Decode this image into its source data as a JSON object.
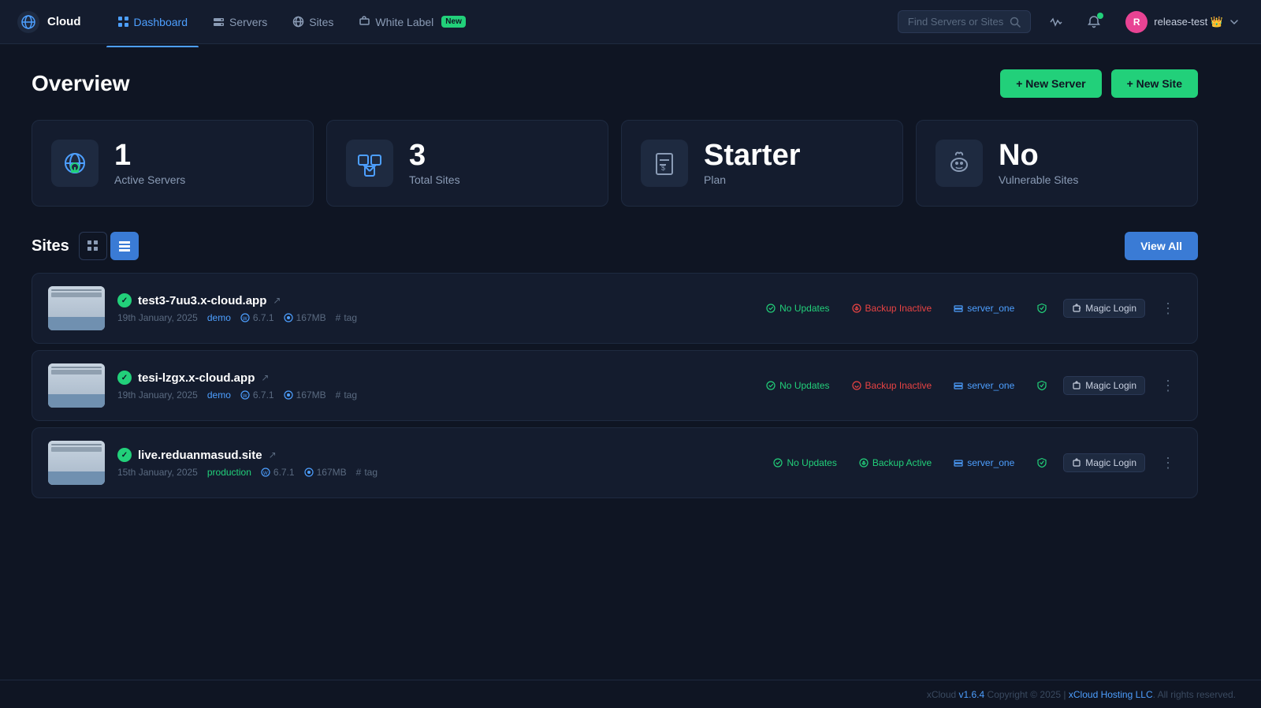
{
  "brand": {
    "name": "Cloud",
    "logo_alt": "xCloud"
  },
  "nav": {
    "items": [
      {
        "id": "dashboard",
        "label": "Dashboard",
        "active": true
      },
      {
        "id": "servers",
        "label": "Servers",
        "active": false
      },
      {
        "id": "sites",
        "label": "Sites",
        "active": false
      },
      {
        "id": "white-label",
        "label": "White Label",
        "active": false,
        "badge": "New"
      }
    ]
  },
  "search": {
    "placeholder": "Find Servers or Sites"
  },
  "user": {
    "name": "release-test",
    "avatar_initial": "R",
    "emoji": "👑"
  },
  "header": {
    "title": "Overview",
    "new_server_label": "+ New Server",
    "new_site_label": "+ New Site"
  },
  "stats": [
    {
      "id": "active-servers",
      "value": "1",
      "label": "Active Servers",
      "icon": "🌐"
    },
    {
      "id": "total-sites",
      "value": "3",
      "label": "Total Sites",
      "icon": "🖧"
    },
    {
      "id": "plan",
      "value": "Starter",
      "label": "Plan",
      "icon": "💲"
    },
    {
      "id": "vulnerable-sites",
      "value": "No",
      "label": "Vulnerable Sites",
      "icon": "🐛"
    }
  ],
  "sites_section": {
    "title": "Sites",
    "view_all_label": "View All"
  },
  "sites": [
    {
      "id": "site-1",
      "name": "test3-7uu3.x-cloud.app",
      "date": "19th January, 2025",
      "tag": "demo",
      "tag_type": "demo",
      "wp_version": "6.7.1",
      "disk": "167MB",
      "tag_hash": "tag",
      "updates": "No Updates",
      "backup": "Backup Inactive",
      "backup_type": "inactive",
      "server": "server_one",
      "magic_login": "Magic Login"
    },
    {
      "id": "site-2",
      "name": "tesi-lzgx.x-cloud.app",
      "date": "19th January, 2025",
      "tag": "demo",
      "tag_type": "demo",
      "wp_version": "6.7.1",
      "disk": "167MB",
      "tag_hash": "tag",
      "updates": "No Updates",
      "backup": "Backup Inactive",
      "backup_type": "inactive",
      "server": "server_one",
      "magic_login": "Magic Login"
    },
    {
      "id": "site-3",
      "name": "live.reduanmasud.site",
      "date": "15th January, 2025",
      "tag": "production",
      "tag_type": "production",
      "wp_version": "6.7.1",
      "disk": "167MB",
      "tag_hash": "tag",
      "updates": "No Updates",
      "backup": "Backup Active",
      "backup_type": "active",
      "server": "server_one",
      "magic_login": "Magic Login"
    }
  ],
  "footer": {
    "text": "xCloud v1.6.4  Copyright © 2025 | xCloud Hosting LLC. All rights reserved."
  }
}
